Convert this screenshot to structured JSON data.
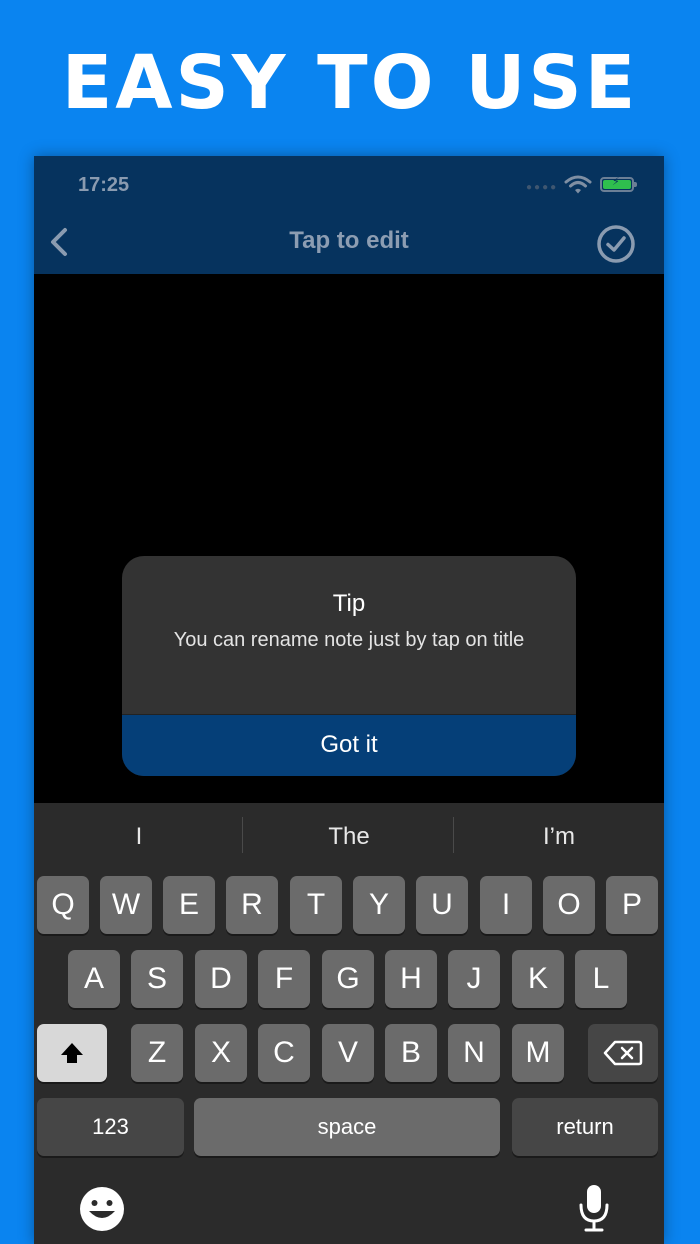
{
  "banner": {
    "headline": "EASY TO USE"
  },
  "status_bar": {
    "time": "17:25"
  },
  "nav": {
    "title": "Tap to edit"
  },
  "dialog": {
    "title": "Tip",
    "message": "You can rename note just by tap on title",
    "button": "Got it"
  },
  "keyboard": {
    "suggestions": [
      "I",
      "The",
      "I’m"
    ],
    "row1": [
      "Q",
      "W",
      "E",
      "R",
      "T",
      "Y",
      "U",
      "I",
      "O",
      "P"
    ],
    "row2": [
      "A",
      "S",
      "D",
      "F",
      "G",
      "H",
      "J",
      "K",
      "L"
    ],
    "row3": [
      "Z",
      "X",
      "C",
      "V",
      "B",
      "N",
      "M"
    ],
    "numbers_label": "123",
    "space_label": "space",
    "return_label": "return"
  },
  "colors": {
    "background": "#0a84f0",
    "navbar": "#06335e",
    "dialog_button": "#053f78",
    "battery": "#2fbf4e"
  }
}
